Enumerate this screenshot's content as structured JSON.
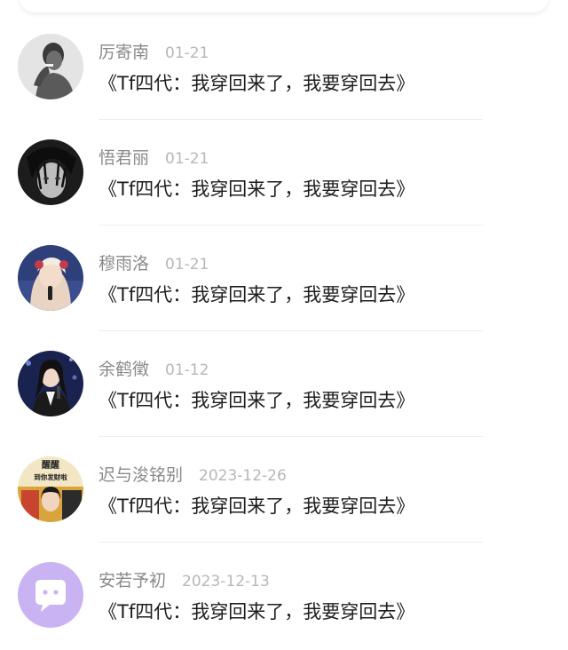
{
  "comments": [
    {
      "name": "厉寄南",
      "date": "01-21",
      "text": "《Tf四代：我穿回来了，我要穿回去》",
      "avatar_icon": "man-portrait-avatar"
    },
    {
      "name": "悟君丽",
      "date": "01-21",
      "text": "《Tf四代：我穿回来了，我要穿回去》",
      "avatar_icon": "wet-hair-portrait-avatar"
    },
    {
      "name": "穆雨洛",
      "date": "01-21",
      "text": "《Tf四代：我穿回来了，我要穿回去》",
      "avatar_icon": "singer-portrait-avatar"
    },
    {
      "name": "余鹤徵",
      "date": "01-12",
      "text": "《Tf四代：我穿回来了，我要穿回去》",
      "avatar_icon": "stage-portrait-avatar"
    },
    {
      "name": "迟与浚铭别",
      "date": "2023-12-26",
      "text": "《Tf四代：我穿回来了，我要穿回去》",
      "avatar_icon": "poster-avatar",
      "avatar_text": [
        "醒醒",
        "到你发财啦"
      ]
    },
    {
      "name": "安若予初",
      "date": "2023-12-13",
      "text": "《Tf四代：我穿回来了，我要穿回去》",
      "avatar_icon": "default-chat-avatar"
    }
  ],
  "colors": {
    "name": "#8a8a8a",
    "date": "#b7b7b7",
    "text": "#1e1e1e",
    "default_avatar": "#c9b3f2"
  }
}
